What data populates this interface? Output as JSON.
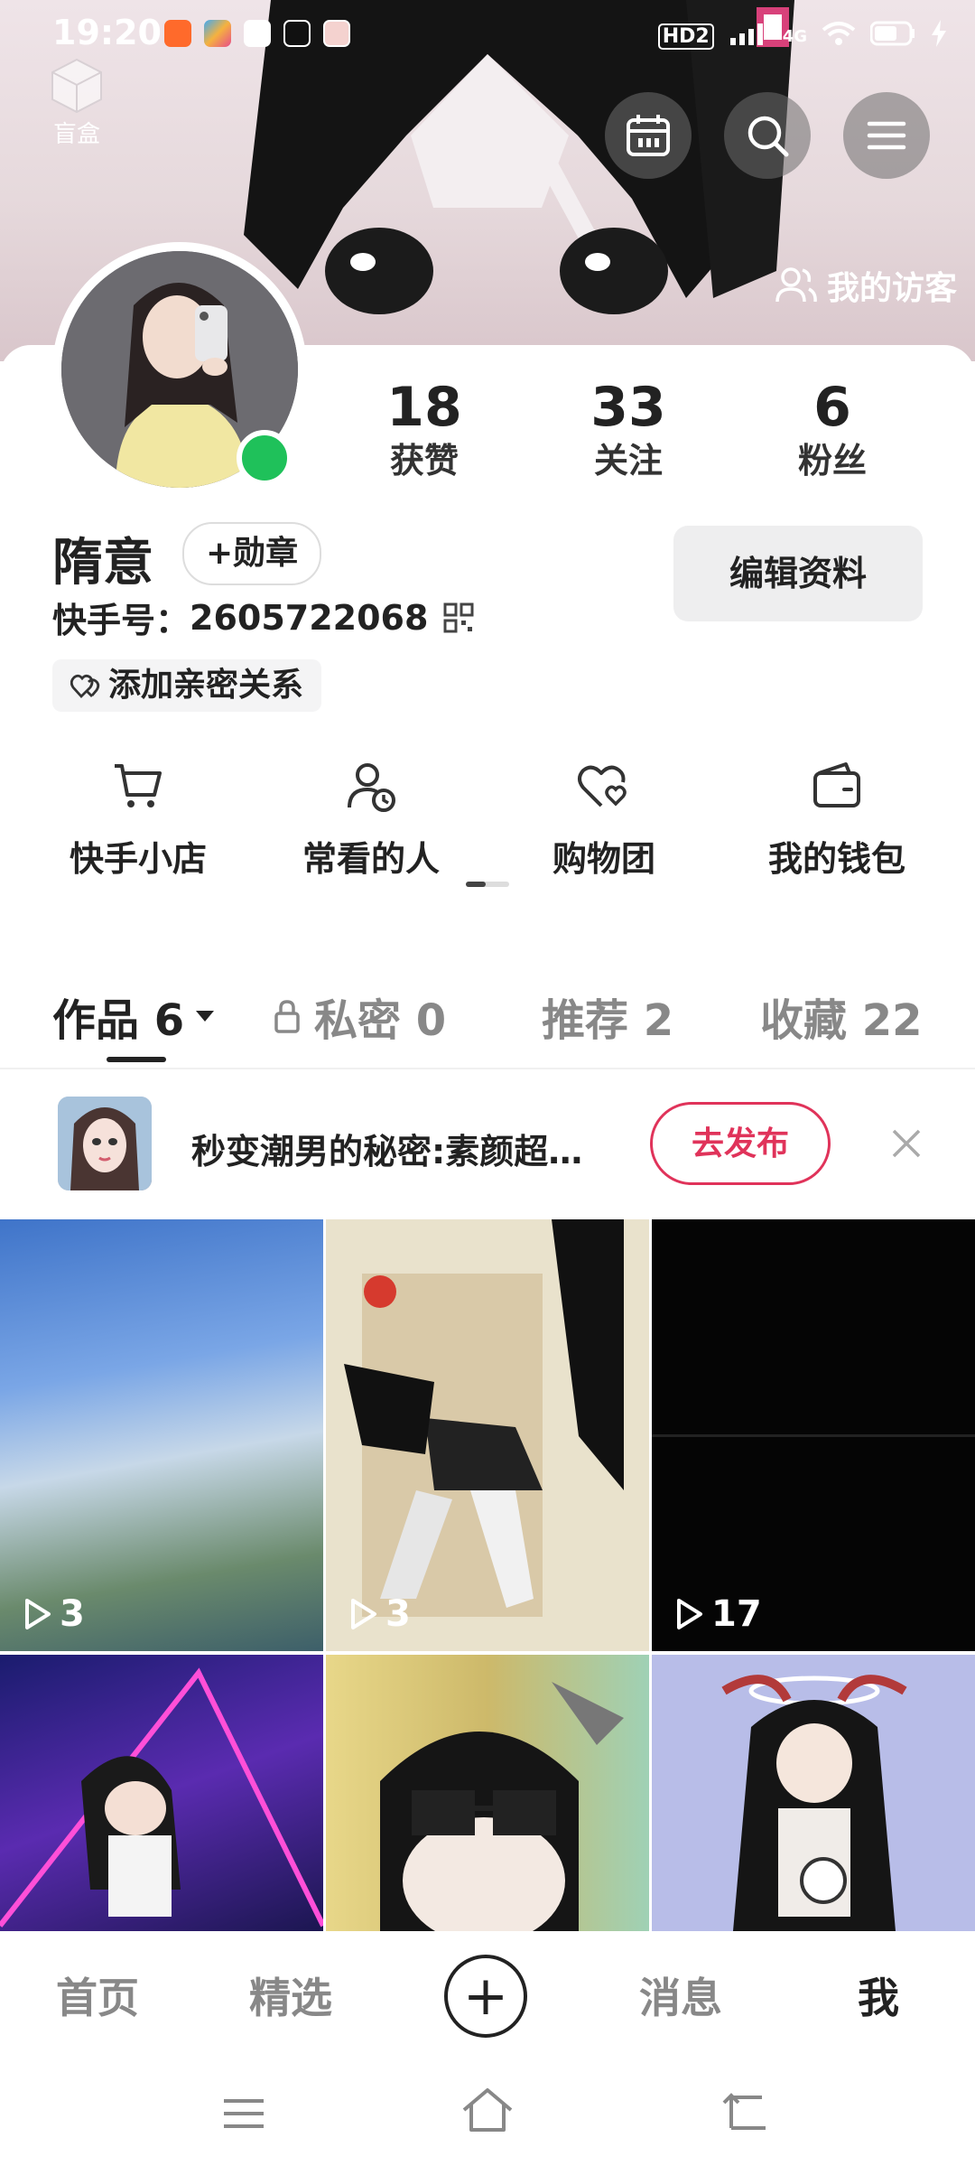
{
  "status_bar": {
    "time": "19:20",
    "network_labels": [
      "HD2",
      "4G"
    ],
    "icons": [
      "app-icon-orange",
      "app-icon-colorful",
      "mail-icon",
      "tiktok-icon",
      "avatar-notification-icon",
      "signal-icon",
      "wifi-icon",
      "battery-icon",
      "charging-icon"
    ]
  },
  "header": {
    "blind_box_label": "盲盒",
    "visitor_label": "我的访客",
    "buttons": [
      "calendar-icon",
      "search-icon",
      "menu-icon"
    ]
  },
  "profile": {
    "name": "隋意",
    "medal_label": "+勋章",
    "user_id_label": "快手号：",
    "user_id": "2605722068",
    "edit_label": "编辑资料",
    "intimate_label": "添加亲密关系",
    "online_color": "#1fc15a"
  },
  "stats": [
    {
      "value": "18",
      "label": "获赞"
    },
    {
      "value": "33",
      "label": "关注"
    },
    {
      "value": "6",
      "label": "粉丝"
    }
  ],
  "shortcuts": [
    {
      "label": "快手小店",
      "icon": "cart-icon"
    },
    {
      "label": "常看的人",
      "icon": "person-clock-icon"
    },
    {
      "label": "购物团",
      "icon": "heart-group-icon"
    },
    {
      "label": "我的钱包",
      "icon": "wallet-icon"
    }
  ],
  "tabs": [
    {
      "label": "作品 6",
      "active": true
    },
    {
      "label": "私密 0",
      "active": false
    },
    {
      "label": "推荐 2",
      "active": false
    },
    {
      "label": "收藏 22",
      "active": false
    }
  ],
  "promo": {
    "text": "秒变潮男的秘密:素颜超…",
    "button_label": "去发布",
    "accent": "#e0335a"
  },
  "videos": [
    {
      "count": "3"
    },
    {
      "count": "3"
    },
    {
      "count": "17"
    },
    {
      "count": ""
    },
    {
      "count": ""
    },
    {
      "count": ""
    }
  ],
  "bottom_nav": [
    {
      "label": "首页",
      "active": false
    },
    {
      "label": "精选",
      "active": false
    },
    {
      "label": "消息",
      "active": false
    },
    {
      "label": "我",
      "active": true
    }
  ],
  "plus_label": "+"
}
